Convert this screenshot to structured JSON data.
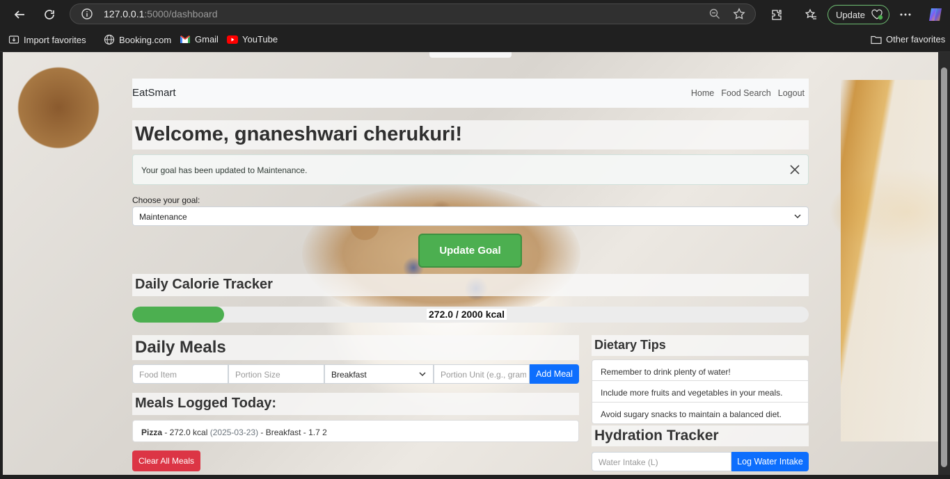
{
  "browser": {
    "url_host": "127.0.0.1",
    "url_path": ":5000/dashboard",
    "update_label": "Update",
    "bookmarks": [
      {
        "label": "Import favorites",
        "icon": "import-icon"
      },
      {
        "label": "Booking.com",
        "icon": "globe-icon"
      },
      {
        "label": "Gmail",
        "icon": "gmail-icon"
      },
      {
        "label": "YouTube",
        "icon": "youtube-icon"
      }
    ],
    "other_favorites": "Other favorites"
  },
  "nav": {
    "brand": "EatSmart",
    "links": [
      "Home",
      "Food Search",
      "Logout"
    ]
  },
  "welcome": "Welcome, gnaneshwari cherukuri!",
  "alert": {
    "message": "Your goal has been updated to Maintenance."
  },
  "goal": {
    "label": "Choose your goal:",
    "selected": "Maintenance",
    "button": "Update Goal"
  },
  "calories": {
    "heading": "Daily Calorie Tracker",
    "label": "272.0 / 2000 kcal",
    "consumed": 272.0,
    "target": 2000
  },
  "meals": {
    "heading": "Daily Meals",
    "food_placeholder": "Food Item",
    "portion_placeholder": "Portion Size",
    "meal_type": "Breakfast",
    "unit_placeholder": "Portion Unit (e.g., gram",
    "add_button": "Add Meal",
    "logged_heading": "Meals Logged Today:",
    "logged": [
      {
        "name": "Pizza",
        "kcal": " - 272.0 kcal ",
        "date": "(2025-03-23)",
        "rest": " - Breakfast - 1.7 2"
      }
    ],
    "clear_button": "Clear All Meals"
  },
  "tips": {
    "heading": "Dietary Tips",
    "items": [
      "Remember to drink plenty of water!",
      "Include more fruits and vegetables in your meals.",
      "Avoid sugary snacks to maintain a balanced diet."
    ]
  },
  "hydration": {
    "heading": "Hydration Tracker",
    "placeholder": "Water Intake (L)",
    "button": "Log Water Intake"
  },
  "colors": {
    "success": "#4caf50",
    "primary": "#0d6efd",
    "danger": "#dc3545"
  }
}
